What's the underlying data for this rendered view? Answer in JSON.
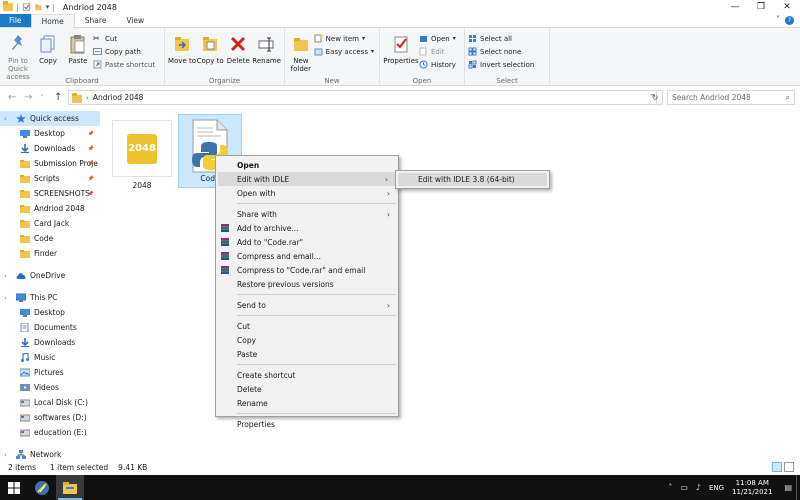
{
  "window": {
    "title": "Andriod 2048",
    "controls": {
      "minimize": "—",
      "maximize": "❐",
      "close": "✕"
    }
  },
  "ribbon_tabs": [
    {
      "label": "File",
      "kind": "file"
    },
    {
      "label": "Home",
      "kind": "active"
    },
    {
      "label": "Share",
      "kind": "normal"
    },
    {
      "label": "View",
      "kind": "normal"
    }
  ],
  "ribbon": {
    "clipboard": {
      "label": "Clipboard",
      "pin_label": "Pin to Quick access",
      "copy_label": "Copy",
      "paste_label": "Paste",
      "cut_label": "Cut",
      "copy_path_label": "Copy path",
      "paste_shortcut_label": "Paste shortcut"
    },
    "organize": {
      "label": "Organize",
      "move_to_label": "Move to",
      "copy_to_label": "Copy to",
      "delete_label": "Delete",
      "rename_label": "Rename"
    },
    "new": {
      "label": "New",
      "new_folder_label": "New folder",
      "new_item_label": "New item",
      "easy_access_label": "Easy access"
    },
    "open": {
      "label": "Open",
      "properties_label": "Properties",
      "open_label": "Open",
      "edit_label": "Edit",
      "history_label": "History"
    },
    "select": {
      "label": "Select",
      "select_all_label": "Select all",
      "select_none_label": "Select none",
      "invert_label": "Invert selection"
    }
  },
  "address": {
    "path": "Andriod 2048",
    "search_placeholder": "Search Andriod 2048"
  },
  "nav_pane": {
    "quick_access": "Quick access",
    "quick_items": [
      {
        "label": "Desktop",
        "pinned": true
      },
      {
        "label": "Downloads",
        "pinned": true
      },
      {
        "label": "Submission Proje",
        "pinned": true
      },
      {
        "label": "Scripts",
        "pinned": true
      },
      {
        "label": "SCREENSHOTS",
        "pinned": true
      },
      {
        "label": "Andriod 2048",
        "pinned": false
      },
      {
        "label": "Card Jack",
        "pinned": false
      },
      {
        "label": "Code",
        "pinned": false
      },
      {
        "label": "Finder",
        "pinned": false
      }
    ],
    "onedrive": "OneDrive",
    "this_pc": "This PC",
    "pc_items": [
      {
        "label": "Desktop"
      },
      {
        "label": "Documents"
      },
      {
        "label": "Downloads"
      },
      {
        "label": "Music"
      },
      {
        "label": "Pictures"
      },
      {
        "label": "Videos"
      },
      {
        "label": "Local Disk (C:)"
      },
      {
        "label": "softwares (D:)"
      },
      {
        "label": "education (E:)"
      }
    ],
    "network": "Network"
  },
  "files": [
    {
      "name": "2048",
      "thumb_text": "2048"
    },
    {
      "name": "Code"
    }
  ],
  "context_menu": {
    "items": [
      {
        "label": "Open",
        "bold": true
      },
      {
        "label": "Edit with IDLE",
        "arrow": true,
        "hover": true
      },
      {
        "label": "Open with",
        "arrow": true
      },
      {
        "sep": true
      },
      {
        "label": "Share with",
        "arrow": true
      },
      {
        "label": "Add to archive...",
        "rar": true
      },
      {
        "label": "Add to \"Code.rar\"",
        "rar": true
      },
      {
        "label": "Compress and email...",
        "rar": true
      },
      {
        "label": "Compress to \"Code.rar\" and email",
        "rar": true
      },
      {
        "label": "Restore previous versions"
      },
      {
        "sep": true
      },
      {
        "label": "Send to",
        "arrow": true
      },
      {
        "sep": true
      },
      {
        "label": "Cut"
      },
      {
        "label": "Copy"
      },
      {
        "label": "Paste"
      },
      {
        "sep": true
      },
      {
        "label": "Create shortcut"
      },
      {
        "label": "Delete"
      },
      {
        "label": "Rename"
      },
      {
        "sep": true
      },
      {
        "label": "Properties"
      }
    ],
    "submenu_item": "Edit with IDLE 3.8 (64-bit)"
  },
  "status": {
    "count": "2 items",
    "selected": "1 item selected",
    "size": "9.41 KB"
  },
  "taskbar": {
    "lang": "ENG",
    "time": "11:08 AM",
    "date": "11/21/2021"
  },
  "colors": {
    "accent": "#1979ca",
    "selection": "#cce8ff",
    "folder": "#f3c64b",
    "tile_2048": "#edc22e"
  }
}
